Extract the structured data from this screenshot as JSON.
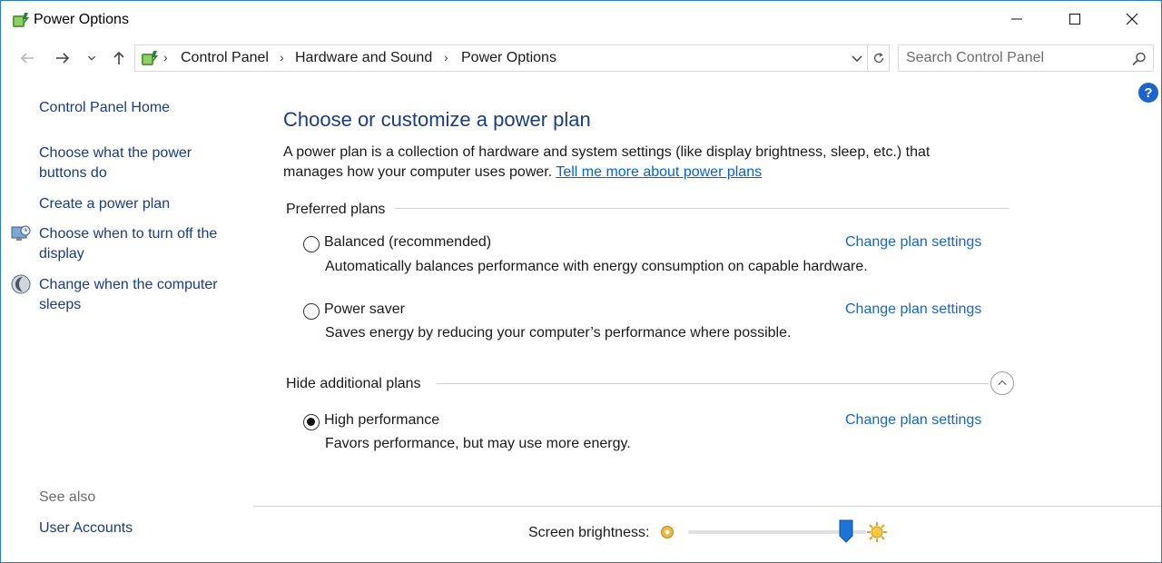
{
  "window": {
    "title": "Power Options"
  },
  "navbar": {
    "breadcrumbs": [
      "Control Panel",
      "Hardware and Sound",
      "Power Options"
    ],
    "search_placeholder": "Search Control Panel"
  },
  "left_pane": {
    "home": "Control Panel Home",
    "tasks": [
      "Choose what the power buttons do",
      "Create a power plan",
      "Choose when to turn off the display",
      "Change when the computer sleeps"
    ],
    "see_also_heading": "See also",
    "see_also_links": [
      "User Accounts"
    ]
  },
  "main": {
    "title": "Choose or customize a power plan",
    "intro_text": "A power plan is a collection of hardware and system settings (like display brightness, sleep, etc.) that manages how your computer uses power. ",
    "intro_link": "Tell me more about power plans",
    "preferred_heading": "Preferred plans",
    "additional_heading": "Hide additional plans",
    "change_label": "Change plan settings",
    "plans": [
      {
        "name": "Balanced (recommended)",
        "description": "Automatically balances performance with energy consumption on capable hardware.",
        "selected": false
      },
      {
        "name": "Power saver",
        "description": "Saves energy by reducing your computer’s performance where possible.",
        "selected": false
      },
      {
        "name": "High performance",
        "description": "Favors performance, but may use more energy.",
        "selected": true
      }
    ]
  },
  "brightness": {
    "label": "Screen brightness:",
    "level": 0.92
  },
  "colors": {
    "link": "#1a3c80",
    "accent": "#1e64c8",
    "hyperlink": "#0066cc"
  }
}
